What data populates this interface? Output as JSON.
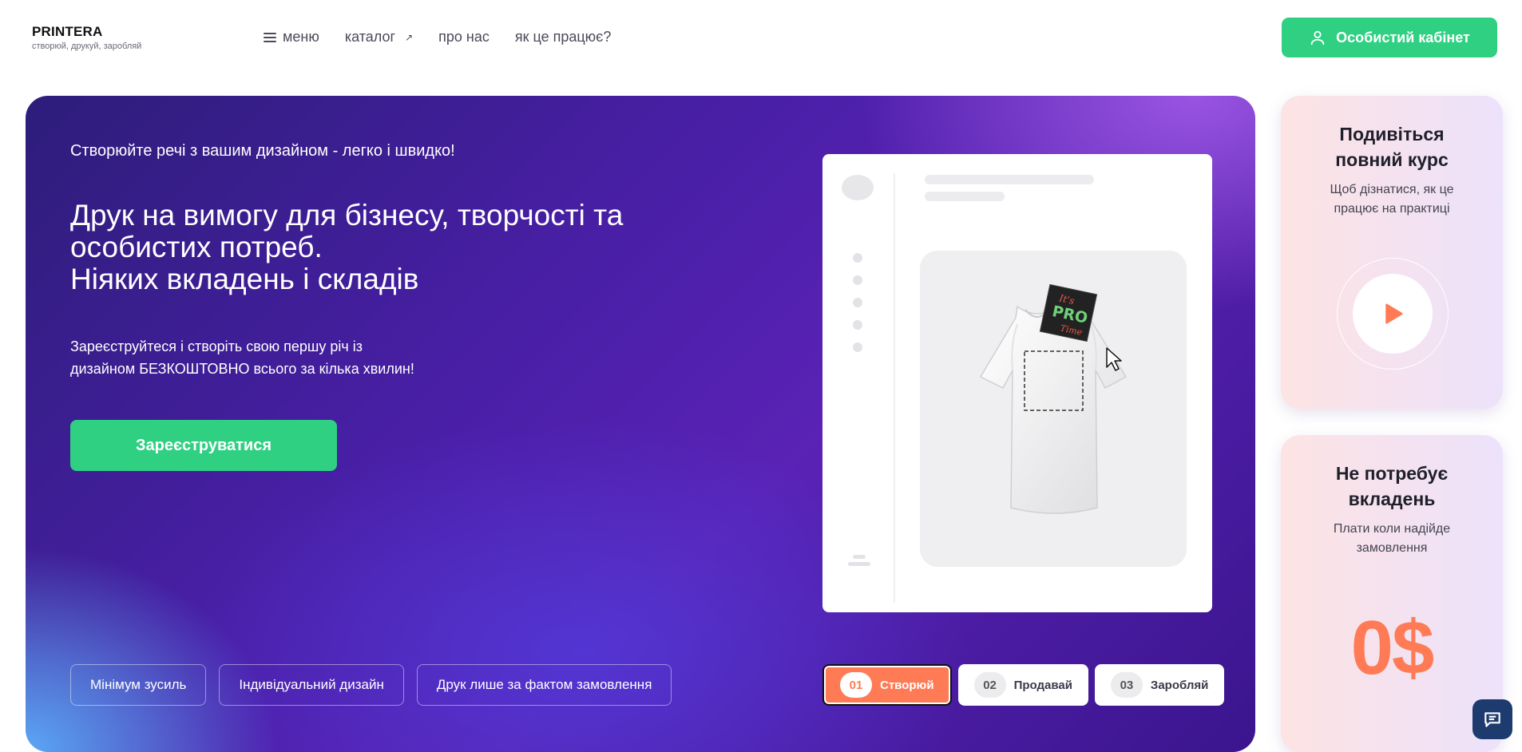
{
  "brand": {
    "name": "PRINTERA",
    "tagline": "створюй, друкуй, заробляй"
  },
  "nav": {
    "menu_label": "меню",
    "items": [
      {
        "label": "каталог",
        "external": true
      },
      {
        "label": "про нас"
      },
      {
        "label": "як це працює?"
      }
    ]
  },
  "header": {
    "account_button": "Особистий кабінет"
  },
  "hero": {
    "kicker": "Створюйте речі з вашим дизайном - легко і швидко!",
    "title_lines": [
      "Друк на вимогу для бізнесу, творчості та",
      "особистих потреб.",
      "Ніяких вкладень і складів"
    ],
    "subtitle_lines": [
      "Зареєструйтеся і створіть свою першу річ із",
      "дизайном БЕЗКОШТОВНО всього за кілька хвилин!"
    ],
    "register_button": "Зареєструватися",
    "chips": [
      "Мінімум зусиль",
      "Індивідуальний дизайн",
      "Друк лише за фактом замовлення"
    ],
    "patch_text": {
      "top": "It's",
      "middle": "PRO",
      "bottom": "Time"
    }
  },
  "steps": [
    {
      "num": "01",
      "label": "Створюй",
      "active": true
    },
    {
      "num": "02",
      "label": "Продавай",
      "active": false
    },
    {
      "num": "03",
      "label": "Заробляй",
      "active": false
    }
  ],
  "cards": {
    "course": {
      "title": "Подивіться повний курс",
      "text": "Щоб дізнатися, як це працює на практиці"
    },
    "invest": {
      "title": "Не потребує вкладень",
      "text": "Плати коли надійде замовлення",
      "price": "0$"
    }
  },
  "colors": {
    "accent_green": "#2fd081",
    "accent_orange": "#ff7b56",
    "hero_purple": "#4a1fa8"
  },
  "icons": {
    "menu": "hamburger-icon",
    "external": "arrow-up-right-icon",
    "account": "user-icon",
    "play": "play-icon",
    "chat": "chat-icon",
    "cursor": "pointer-cursor-icon"
  }
}
